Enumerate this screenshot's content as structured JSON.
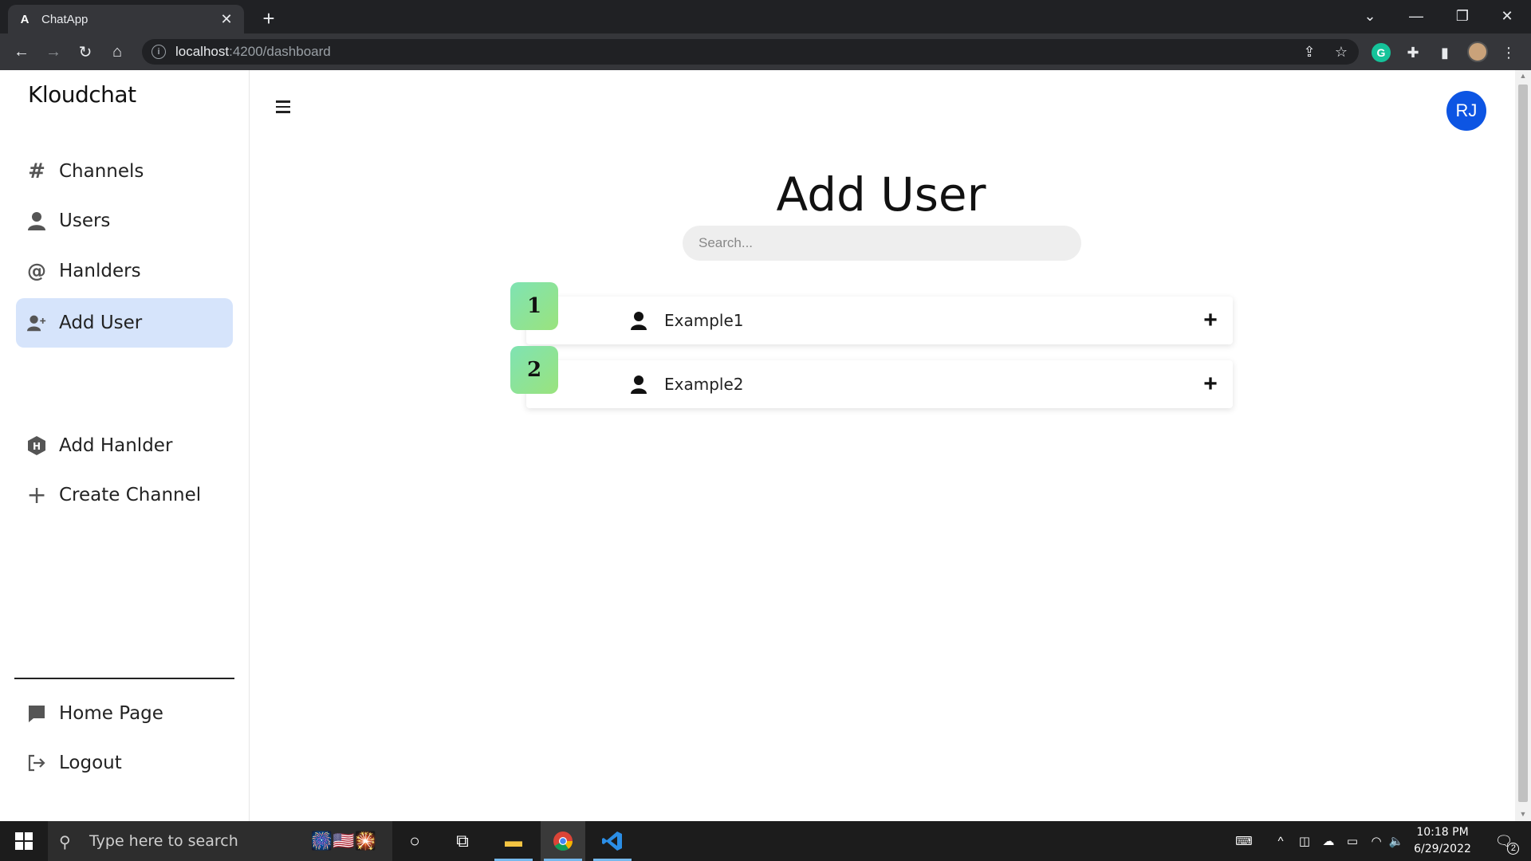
{
  "browser": {
    "tab_title": "ChatApp",
    "favicon_letter": "A",
    "url_host": "localhost",
    "url_path": ":4200/dashboard"
  },
  "sidebar": {
    "brand": "Kloudchat",
    "items": [
      {
        "label": "Channels",
        "icon": "hash-icon"
      },
      {
        "label": "Users",
        "icon": "user-icon"
      },
      {
        "label": "Hanlders",
        "icon": "at-icon"
      },
      {
        "label": "Add User",
        "icon": "user-plus-icon",
        "active": true
      },
      {
        "label": "Add Hanlder",
        "icon": "hexagon-h-icon"
      },
      {
        "label": "Create Channel",
        "icon": "plus-icon"
      }
    ],
    "footer_items": [
      {
        "label": "Home Page",
        "icon": "chat-bubble-icon"
      },
      {
        "label": "Logout",
        "icon": "logout-icon"
      }
    ]
  },
  "header": {
    "avatar_initials": "RJ",
    "avatar_color": "#0d55e3"
  },
  "main": {
    "title": "Add User",
    "search_placeholder": "Search...",
    "users": [
      {
        "index": "1",
        "name": "Example1"
      },
      {
        "index": "2",
        "name": "Example2"
      }
    ],
    "add_symbol": "+"
  },
  "taskbar": {
    "search_placeholder": "Type here to search",
    "time": "10:18 PM",
    "date": "6/29/2022",
    "notifications": "2"
  },
  "colors": {
    "active_nav": "#d6e4fb",
    "badge_gradient_start": "#7fe3b3",
    "badge_gradient_end": "#9ae37d"
  }
}
